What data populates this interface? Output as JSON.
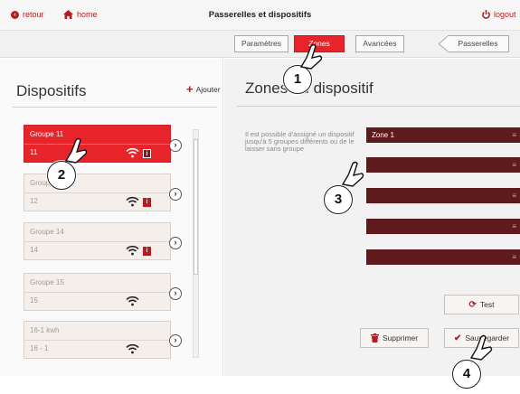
{
  "header": {
    "back_label": "retour",
    "home_label": "home",
    "title": "Passerelles et dispositifs",
    "logout_label": "logout"
  },
  "tabs": {
    "parametres": "Paramètres",
    "zones": "Zones",
    "avancees": "Avancées",
    "passerelles": "Passerelles"
  },
  "left": {
    "title": "Dispositifs",
    "add_label": "Ajouter",
    "devices": [
      {
        "name": "Groupe 11",
        "id": "11",
        "selected": true
      },
      {
        "name": "Groupe 12",
        "id": "12",
        "selected": false
      },
      {
        "name": "Groupe 14",
        "id": "14",
        "selected": false
      },
      {
        "name": "Groupe 15",
        "id": "15",
        "selected": false
      },
      {
        "name": "16-1 kwh",
        "id": "16 - 1",
        "selected": false
      }
    ]
  },
  "right": {
    "title": "Zones du dispositif",
    "description": "Il est possible d'assigné un dispositif jusqu'à 5 groupes différents ou de le laisser sans groupe",
    "zones": [
      "Zone 1",
      "",
      "",
      "",
      ""
    ],
    "test_label": "Test",
    "delete_label": "Supprimer",
    "save_label": "Sauvegarder"
  },
  "markers": [
    "1",
    "2",
    "3",
    "4"
  ],
  "colors": {
    "accent": "#e8242b",
    "brand": "#b41e22",
    "zone_bg": "#5e1a1c"
  }
}
